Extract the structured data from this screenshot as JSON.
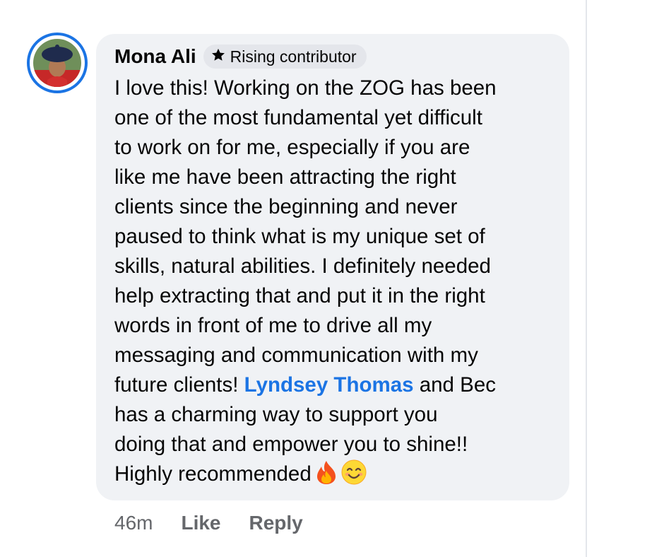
{
  "comment": {
    "author": "Mona Ali",
    "badge": {
      "icon": "star-icon",
      "label": "Rising contributor"
    },
    "text_before_mention": "I love this! Working on the ZOG has been\none of the most fundamental yet difficult\nto work on for me, especially if you are\nlike me have been attracting the right\nclients since the beginning and never\npaused to think what is my unique set of\nskills, natural abilities. I definitely needed\nhelp extracting that and put it in the right\nwords in front of me to drive all my\nmessaging and communication with my\nfuture clients! ",
    "mention": "Lyndsey Thomas",
    "text_after_mention": " and Bec\nhas a charming way to support you\ndoing that and empower you to shine!!\nHighly recommended",
    "emojis": [
      "fire-emoji",
      "smiling-face-emoji"
    ]
  },
  "actions": {
    "timestamp": "46m",
    "like_label": "Like",
    "reply_label": "Reply"
  },
  "colors": {
    "accent": "#1b74e4",
    "bubble": "#f0f2f5",
    "muted_text": "#65676b"
  }
}
